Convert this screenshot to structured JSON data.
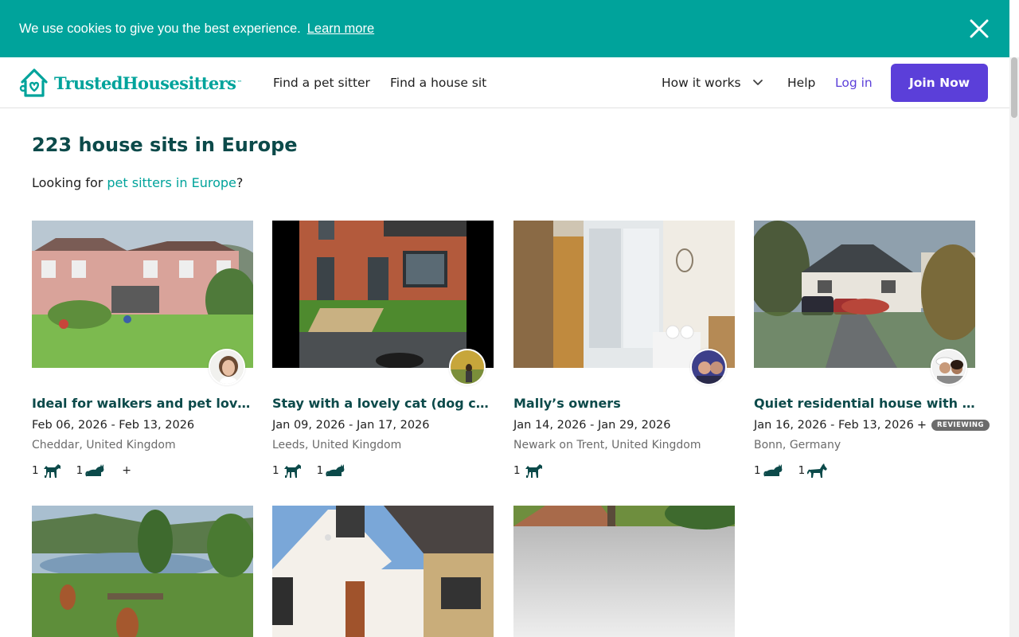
{
  "cookie_banner": {
    "text": "We use cookies to give you the best experience.",
    "link": "Learn more",
    "close_icon": "close-icon"
  },
  "header": {
    "logo_text": "TrustedHousesitters",
    "logo_tm": "™",
    "nav": {
      "find_pet_sitter": "Find a pet sitter",
      "find_house_sit": "Find a house sit",
      "how_it_works": "How it works",
      "help": "Help",
      "login": "Log in",
      "join": "Join Now"
    }
  },
  "main": {
    "title": "223 house sits in Europe",
    "subline_prefix": "Looking for ",
    "subline_link": "pet sitters in Europe",
    "subline_suffix": "?"
  },
  "listings": [
    {
      "title": "Ideal for walkers and pet lovers",
      "dates": "Feb 06, 2026 - Feb 13, 2026",
      "location": "Cheddar, United Kingdom",
      "pets": [
        {
          "count": "1",
          "icon": "dog-icon"
        },
        {
          "count": "1",
          "icon": "cat-icon"
        }
      ],
      "more": "+"
    },
    {
      "title": "Stay with a lovely cat (dog coming soon)",
      "dates": "Jan 09, 2026 - Jan 17, 2026",
      "location": "Leeds, United Kingdom",
      "pets": [
        {
          "count": "1",
          "icon": "dog-icon"
        },
        {
          "count": "1",
          "icon": "cat-icon"
        }
      ]
    },
    {
      "title": "Mally’s owners",
      "dates": "Jan 14, 2026 - Jan 29, 2026",
      "location": "Newark on Trent, United Kingdom",
      "pets": [
        {
          "count": "1",
          "icon": "dog-icon"
        }
      ]
    },
    {
      "title": "Quiet residential house with cuddly pets",
      "dates": "Jan 16, 2026 - Feb 13, 2026",
      "dates_more": "+",
      "badge": "REVIEWING",
      "location": "Bonn, Germany",
      "pets": [
        {
          "count": "1",
          "icon": "cat-icon"
        },
        {
          "count": "1",
          "icon": "horse-icon"
        }
      ]
    }
  ],
  "colors": {
    "teal": "#00a39b",
    "dark_teal": "#0c4a4a",
    "purple": "#5b3fd9"
  }
}
